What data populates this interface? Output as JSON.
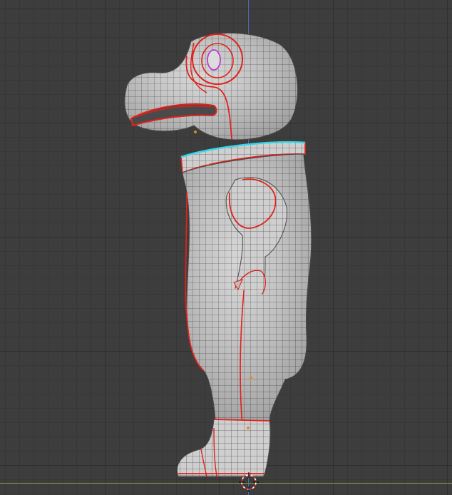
{
  "viewport": {
    "colors": {
      "background": "#3d3d3d",
      "grid_major": "#2f2f2f",
      "grid_minor": "#373737",
      "axis_z": "#4f6bb0",
      "axis_y": "#7ea33c",
      "mesh_fill": "#cfcfcf",
      "wire": "#5a5a5a",
      "seam": "#e0221b",
      "selected_edge": "#33d6e6",
      "eye_edge": "#c03ccd",
      "vertex_dot": "#e08a1e"
    },
    "model_icon": "mesh-object",
    "cursor_icon": "3d-cursor-icon"
  }
}
